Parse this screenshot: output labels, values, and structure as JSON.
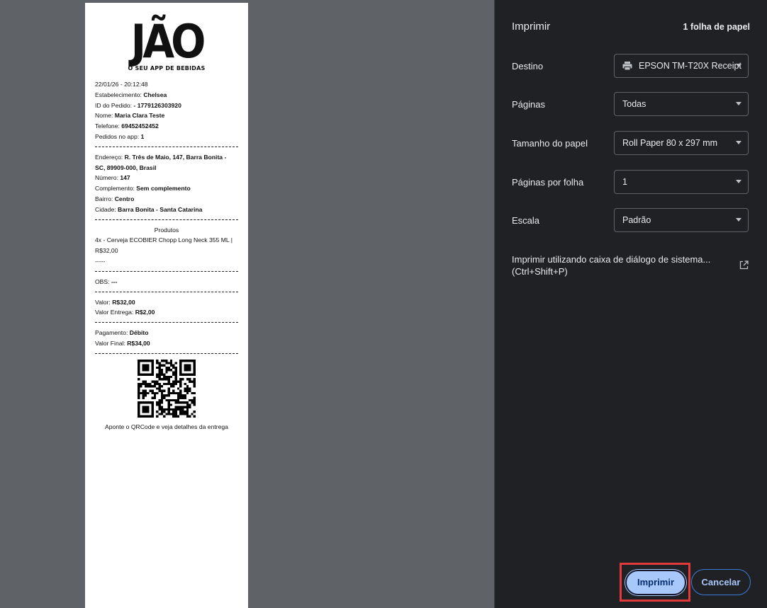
{
  "receipt": {
    "logo_word": "JÃO",
    "logo_tagline": "O SEU APP DE BEBIDAS",
    "datetime": "22/01/26 - 20:12:48",
    "estabelecimento_label": "Estabelecimento: ",
    "estabelecimento_value": "Chelsea",
    "pedido_label": "ID do Pedido: ",
    "pedido_value": " - 1779126303920",
    "nome_label": "Nome: ",
    "nome_value": "Maria Clara Teste",
    "telefone_label": "Telefone: ",
    "telefone_value": "69452452452",
    "pedidos_app_label": "Pedidos no app: ",
    "pedidos_app_value": "1",
    "endereco_label": "Endereço: ",
    "endereco_value": "R. Três de Maio, 147, Barra Bonita - SC, 89909-000, Brasil",
    "numero_label": "Número: ",
    "numero_value": "147",
    "complemento_label": "Complemento: ",
    "complemento_value": "Sem complemento",
    "bairro_label": "Bairro: ",
    "bairro_value": "Centro",
    "cidade_label": "Cidade: ",
    "cidade_value": "Barra Bonita - Santa Catarina",
    "produtos_title": "Produtos",
    "produto_line": "4x -  Cerveja ECOBIER Chopp Long Neck 355 ML | R$32,00",
    "produto_sep": "-----",
    "obs_label": "OBS: ",
    "obs_value": "---",
    "valor_label": "Valor: ",
    "valor_value": "R$32,00",
    "entrega_label": "Valor Entrega: ",
    "entrega_value": "R$2,00",
    "pagamento_label": "Pagamento: ",
    "pagamento_value": "Débito",
    "final_label": "Valor Final: ",
    "final_value": "R$34,00",
    "qr_caption": "Aponte o QRCode e veja detalhes da entrega"
  },
  "sidebar": {
    "title": "Imprimir",
    "sheets": "1 folha de papel",
    "destino_label": "Destino",
    "destino_value": "EPSON TM-T20X Receipt",
    "paginas_label": "Páginas",
    "paginas_value": "Todas",
    "tamanho_label": "Tamanho do papel",
    "tamanho_value": "Roll Paper 80 x 297 mm",
    "por_folha_label": "Páginas por folha",
    "por_folha_value": "1",
    "escala_label": "Escala",
    "escala_value": "Padrão",
    "sysdialog_line1": "Imprimir utilizando caixa de diálogo de sistema...",
    "sysdialog_line2": "(Ctrl+Shift+P)",
    "print_label": "Imprimir",
    "cancel_label": "Cancelar"
  },
  "colors": {
    "preview_bg": "#5f6368",
    "sidebar_bg": "#202124",
    "primary_button": "#a8c7fa",
    "highlight": "#e03a3a"
  }
}
